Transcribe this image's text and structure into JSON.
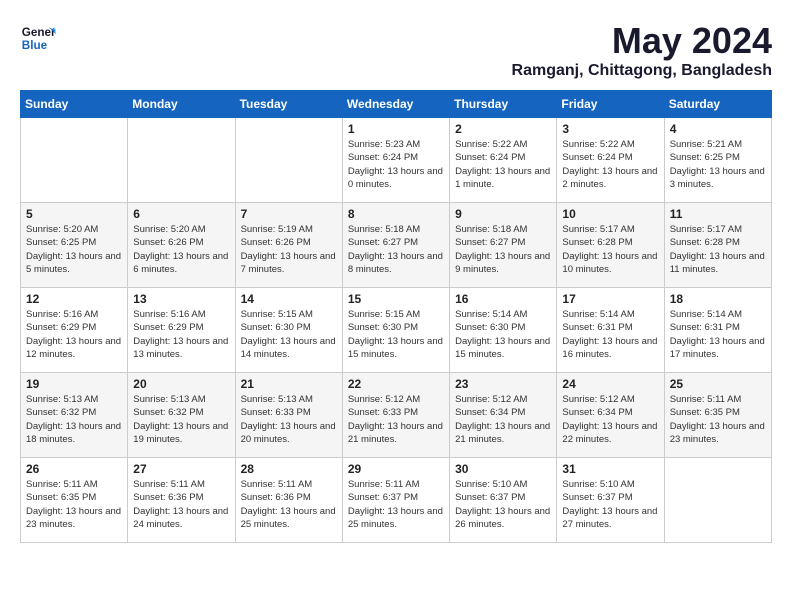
{
  "header": {
    "logo_line1": "General",
    "logo_line2": "Blue",
    "month": "May 2024",
    "location": "Ramganj, Chittagong, Bangladesh"
  },
  "weekdays": [
    "Sunday",
    "Monday",
    "Tuesday",
    "Wednesday",
    "Thursday",
    "Friday",
    "Saturday"
  ],
  "weeks": [
    [
      {
        "day": "",
        "sunrise": "",
        "sunset": "",
        "daylight": ""
      },
      {
        "day": "",
        "sunrise": "",
        "sunset": "",
        "daylight": ""
      },
      {
        "day": "",
        "sunrise": "",
        "sunset": "",
        "daylight": ""
      },
      {
        "day": "1",
        "sunrise": "Sunrise: 5:23 AM",
        "sunset": "Sunset: 6:24 PM",
        "daylight": "Daylight: 13 hours and 0 minutes."
      },
      {
        "day": "2",
        "sunrise": "Sunrise: 5:22 AM",
        "sunset": "Sunset: 6:24 PM",
        "daylight": "Daylight: 13 hours and 1 minute."
      },
      {
        "day": "3",
        "sunrise": "Sunrise: 5:22 AM",
        "sunset": "Sunset: 6:24 PM",
        "daylight": "Daylight: 13 hours and 2 minutes."
      },
      {
        "day": "4",
        "sunrise": "Sunrise: 5:21 AM",
        "sunset": "Sunset: 6:25 PM",
        "daylight": "Daylight: 13 hours and 3 minutes."
      }
    ],
    [
      {
        "day": "5",
        "sunrise": "Sunrise: 5:20 AM",
        "sunset": "Sunset: 6:25 PM",
        "daylight": "Daylight: 13 hours and 5 minutes."
      },
      {
        "day": "6",
        "sunrise": "Sunrise: 5:20 AM",
        "sunset": "Sunset: 6:26 PM",
        "daylight": "Daylight: 13 hours and 6 minutes."
      },
      {
        "day": "7",
        "sunrise": "Sunrise: 5:19 AM",
        "sunset": "Sunset: 6:26 PM",
        "daylight": "Daylight: 13 hours and 7 minutes."
      },
      {
        "day": "8",
        "sunrise": "Sunrise: 5:18 AM",
        "sunset": "Sunset: 6:27 PM",
        "daylight": "Daylight: 13 hours and 8 minutes."
      },
      {
        "day": "9",
        "sunrise": "Sunrise: 5:18 AM",
        "sunset": "Sunset: 6:27 PM",
        "daylight": "Daylight: 13 hours and 9 minutes."
      },
      {
        "day": "10",
        "sunrise": "Sunrise: 5:17 AM",
        "sunset": "Sunset: 6:28 PM",
        "daylight": "Daylight: 13 hours and 10 minutes."
      },
      {
        "day": "11",
        "sunrise": "Sunrise: 5:17 AM",
        "sunset": "Sunset: 6:28 PM",
        "daylight": "Daylight: 13 hours and 11 minutes."
      }
    ],
    [
      {
        "day": "12",
        "sunrise": "Sunrise: 5:16 AM",
        "sunset": "Sunset: 6:29 PM",
        "daylight": "Daylight: 13 hours and 12 minutes."
      },
      {
        "day": "13",
        "sunrise": "Sunrise: 5:16 AM",
        "sunset": "Sunset: 6:29 PM",
        "daylight": "Daylight: 13 hours and 13 minutes."
      },
      {
        "day": "14",
        "sunrise": "Sunrise: 5:15 AM",
        "sunset": "Sunset: 6:30 PM",
        "daylight": "Daylight: 13 hours and 14 minutes."
      },
      {
        "day": "15",
        "sunrise": "Sunrise: 5:15 AM",
        "sunset": "Sunset: 6:30 PM",
        "daylight": "Daylight: 13 hours and 15 minutes."
      },
      {
        "day": "16",
        "sunrise": "Sunrise: 5:14 AM",
        "sunset": "Sunset: 6:30 PM",
        "daylight": "Daylight: 13 hours and 15 minutes."
      },
      {
        "day": "17",
        "sunrise": "Sunrise: 5:14 AM",
        "sunset": "Sunset: 6:31 PM",
        "daylight": "Daylight: 13 hours and 16 minutes."
      },
      {
        "day": "18",
        "sunrise": "Sunrise: 5:14 AM",
        "sunset": "Sunset: 6:31 PM",
        "daylight": "Daylight: 13 hours and 17 minutes."
      }
    ],
    [
      {
        "day": "19",
        "sunrise": "Sunrise: 5:13 AM",
        "sunset": "Sunset: 6:32 PM",
        "daylight": "Daylight: 13 hours and 18 minutes."
      },
      {
        "day": "20",
        "sunrise": "Sunrise: 5:13 AM",
        "sunset": "Sunset: 6:32 PM",
        "daylight": "Daylight: 13 hours and 19 minutes."
      },
      {
        "day": "21",
        "sunrise": "Sunrise: 5:13 AM",
        "sunset": "Sunset: 6:33 PM",
        "daylight": "Daylight: 13 hours and 20 minutes."
      },
      {
        "day": "22",
        "sunrise": "Sunrise: 5:12 AM",
        "sunset": "Sunset: 6:33 PM",
        "daylight": "Daylight: 13 hours and 21 minutes."
      },
      {
        "day": "23",
        "sunrise": "Sunrise: 5:12 AM",
        "sunset": "Sunset: 6:34 PM",
        "daylight": "Daylight: 13 hours and 21 minutes."
      },
      {
        "day": "24",
        "sunrise": "Sunrise: 5:12 AM",
        "sunset": "Sunset: 6:34 PM",
        "daylight": "Daylight: 13 hours and 22 minutes."
      },
      {
        "day": "25",
        "sunrise": "Sunrise: 5:11 AM",
        "sunset": "Sunset: 6:35 PM",
        "daylight": "Daylight: 13 hours and 23 minutes."
      }
    ],
    [
      {
        "day": "26",
        "sunrise": "Sunrise: 5:11 AM",
        "sunset": "Sunset: 6:35 PM",
        "daylight": "Daylight: 13 hours and 23 minutes."
      },
      {
        "day": "27",
        "sunrise": "Sunrise: 5:11 AM",
        "sunset": "Sunset: 6:36 PM",
        "daylight": "Daylight: 13 hours and 24 minutes."
      },
      {
        "day": "28",
        "sunrise": "Sunrise: 5:11 AM",
        "sunset": "Sunset: 6:36 PM",
        "daylight": "Daylight: 13 hours and 25 minutes."
      },
      {
        "day": "29",
        "sunrise": "Sunrise: 5:11 AM",
        "sunset": "Sunset: 6:37 PM",
        "daylight": "Daylight: 13 hours and 25 minutes."
      },
      {
        "day": "30",
        "sunrise": "Sunrise: 5:10 AM",
        "sunset": "Sunset: 6:37 PM",
        "daylight": "Daylight: 13 hours and 26 minutes."
      },
      {
        "day": "31",
        "sunrise": "Sunrise: 5:10 AM",
        "sunset": "Sunset: 6:37 PM",
        "daylight": "Daylight: 13 hours and 27 minutes."
      },
      {
        "day": "",
        "sunrise": "",
        "sunset": "",
        "daylight": ""
      }
    ]
  ]
}
